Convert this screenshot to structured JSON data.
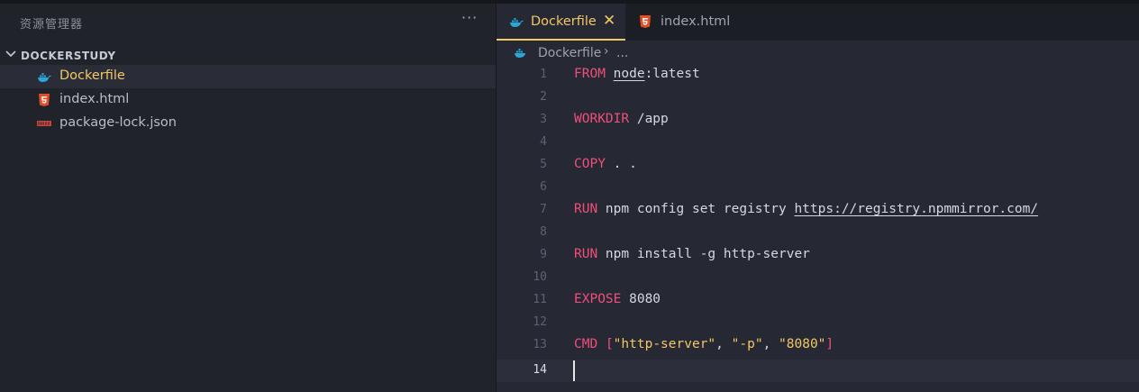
{
  "explorer": {
    "title": "资源管理器",
    "more": "···",
    "folder": "DOCKERSTUDY",
    "files": [
      {
        "label": "Dockerfile",
        "icon": "docker-whale-icon",
        "active": true
      },
      {
        "label": "index.html",
        "icon": "html5-icon",
        "active": false
      },
      {
        "label": "package-lock.json",
        "icon": "npm-icon",
        "active": false
      }
    ]
  },
  "tabs": [
    {
      "label": "Dockerfile",
      "icon": "docker-whale-icon",
      "active": true,
      "close": "✕"
    },
    {
      "label": "index.html",
      "icon": "html5-icon",
      "active": false
    }
  ],
  "breadcrumb": {
    "file": "Dockerfile",
    "separator": "›",
    "more": "..."
  },
  "editor": {
    "current_line": 14,
    "lines": [
      {
        "n": "1",
        "kw": "FROM",
        "rest": "",
        "image": "node",
        "tag": ":latest"
      },
      {
        "n": "2"
      },
      {
        "n": "3",
        "kw": "WORKDIR",
        "rest": " /app"
      },
      {
        "n": "4"
      },
      {
        "n": "5",
        "kw": "COPY",
        "rest": " . ."
      },
      {
        "n": "6"
      },
      {
        "n": "7",
        "kw": "RUN",
        "rest": " npm config set registry ",
        "url": "https://registry.npmmirror.com/"
      },
      {
        "n": "8"
      },
      {
        "n": "9",
        "kw": "RUN",
        "rest": " npm install -g http-server"
      },
      {
        "n": "10"
      },
      {
        "n": "11",
        "kw": "EXPOSE",
        "rest": " 8080"
      },
      {
        "n": "12"
      },
      {
        "n": "13",
        "kw": "CMD",
        "rest": " ",
        "cmd_array": [
          "[",
          "\"http-server\"",
          ", ",
          "\"-p\"",
          ", ",
          "\"8080\"",
          "]"
        ]
      },
      {
        "n": "14"
      }
    ]
  },
  "colors": {
    "accent": "#f2c766",
    "keyword": "#ef4f7a",
    "docker": "#2aa6d8",
    "html5": "#e44d26",
    "npm": "#c4463f"
  }
}
